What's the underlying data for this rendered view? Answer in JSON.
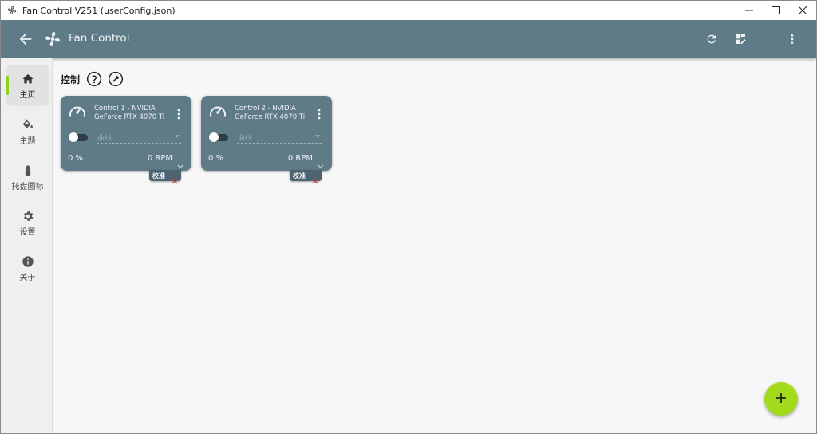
{
  "window": {
    "title": "Fan Control V251 (userConfig.json)"
  },
  "appbar": {
    "title": "Fan Control"
  },
  "sidebar": {
    "items": [
      {
        "label": "主页",
        "icon": "home-icon"
      },
      {
        "label": "主题",
        "icon": "paint-bucket-icon"
      },
      {
        "label": "托盘图标",
        "icon": "thermometer-icon"
      },
      {
        "label": "设置",
        "icon": "gear-icon"
      },
      {
        "label": "关于",
        "icon": "info-icon"
      }
    ]
  },
  "section": {
    "title": "控制"
  },
  "controls": [
    {
      "name": "Control 1 - NVIDIA GeForce RTX 4070 Ti",
      "curve_placeholder": "曲线",
      "percent": "0 %",
      "rpm": "0 RPM",
      "calibrate": "校准",
      "enabled": false
    },
    {
      "name": "Control 2 - NVIDIA GeForce RTX 4070 Ti",
      "curve_placeholder": "曲线",
      "percent": "0 %",
      "rpm": "0 RPM",
      "calibrate": "校准",
      "enabled": false
    }
  ],
  "colors": {
    "header": "#5f7b88",
    "accent": "#a4da1c",
    "card": "#5f7b88",
    "nav_indicator": "#8fd11f"
  }
}
